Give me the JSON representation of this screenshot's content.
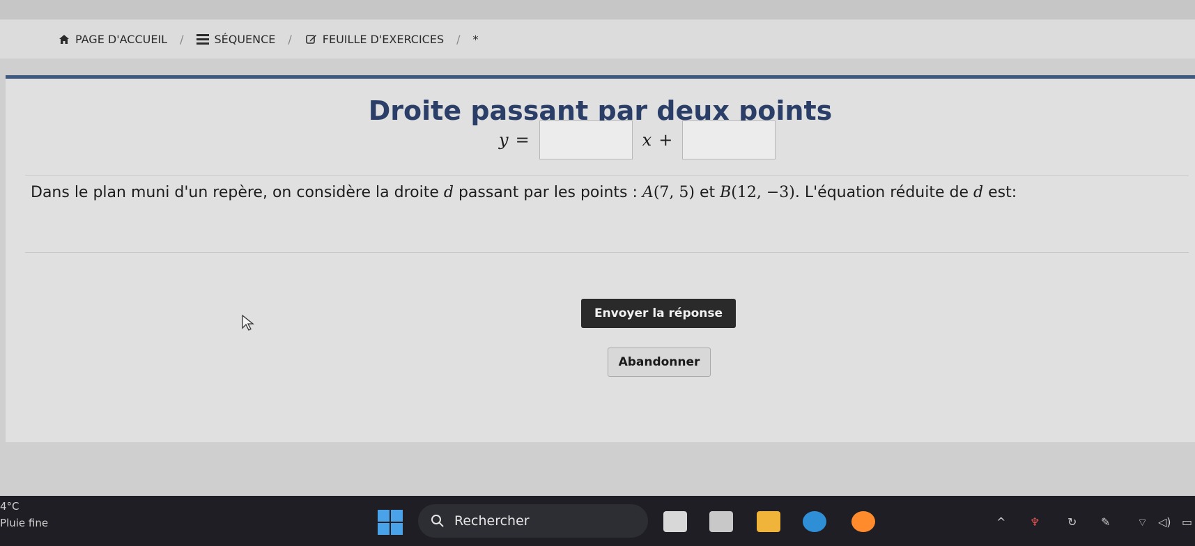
{
  "breadcrumb": {
    "home": "PAGE D'ACCUEIL",
    "sequence": "SÉQUENCE",
    "worksheet": "FEUILLE D'EXERCICES",
    "current": "*"
  },
  "exercise": {
    "title": "Droite passant par deux points",
    "q_part1": "Dans le plan muni d'un repère, on considère la droite ",
    "d1": "d",
    "q_part2": " passant par les points : ",
    "pointA": "A",
    "pointA_coords": "(7, 5)",
    "q_and": " et ",
    "pointB": "B",
    "pointB_coords": "(12, −3)",
    "q_part3": ". L'équation réduite de ",
    "d2": "d",
    "q_part4": " est:",
    "eq_y": "y",
    "eq_equals": "=",
    "eq_x": "x",
    "eq_plus": "+",
    "slope_value": "",
    "intercept_value": ""
  },
  "buttons": {
    "submit": "Envoyer la réponse",
    "abandon": "Abandonner"
  },
  "taskbar": {
    "temperature": "4°C",
    "weather": "Pluie fine",
    "search_label": "Rechercher"
  },
  "colors": {
    "title": "#2a3e68",
    "accent_bar": "#3d5a80",
    "taskbar": "#1e1e24"
  }
}
